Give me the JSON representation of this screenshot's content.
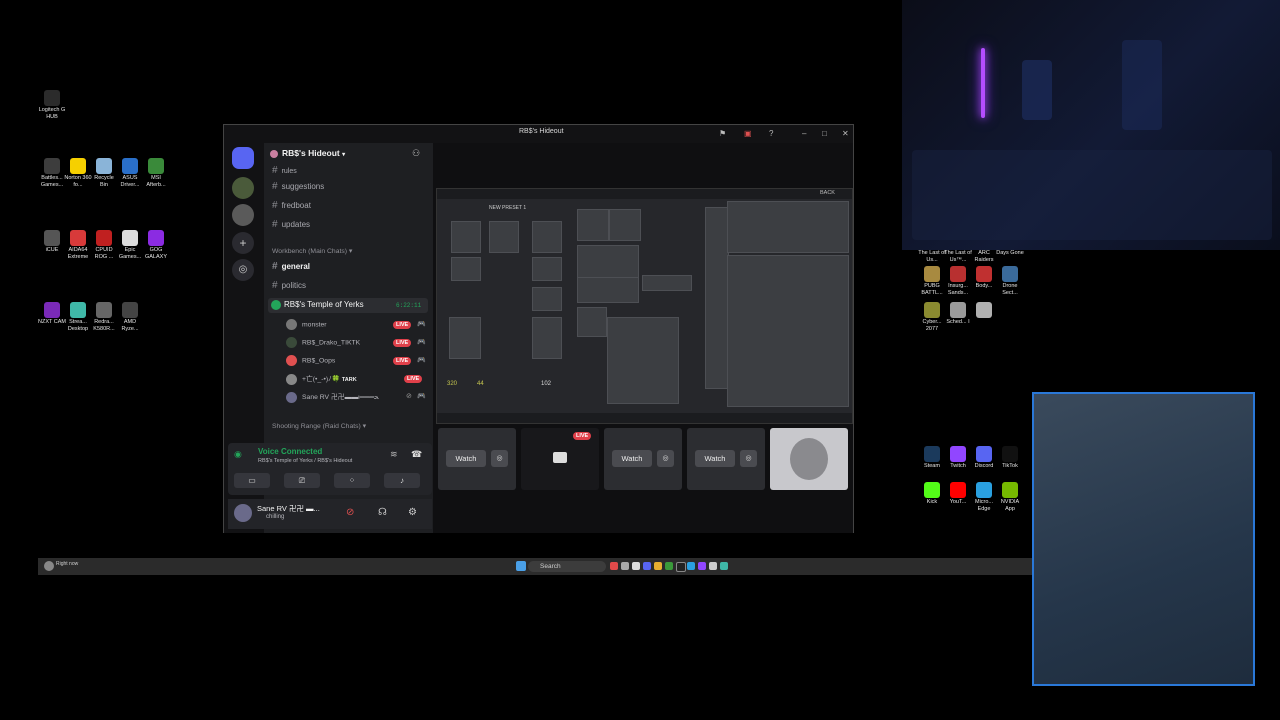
{
  "desktop_icons": [
    {
      "label": "Logitech G HUB",
      "color": "#2b2b2b"
    },
    {
      "label": "Battles... Games...",
      "color": "#3d3d3d"
    },
    {
      "label": "Norton 360 fo...",
      "color": "#f6d000"
    },
    {
      "label": "Recycle Bin",
      "color": "#8ab4d8"
    },
    {
      "label": "ASUS Driver...",
      "color": "#2a6fc9"
    },
    {
      "label": "MSI Afterb...",
      "color": "#3a8a3a"
    },
    {
      "label": "iCUE",
      "color": "#555555"
    },
    {
      "label": "AIDA64 Extreme",
      "color": "#d83a3a"
    },
    {
      "label": "CPUID ROG ...",
      "color": "#c02020"
    },
    {
      "label": "Epic Games...",
      "color": "#dddddd"
    },
    {
      "label": "GOG GALAXY",
      "color": "#8b2be2"
    },
    {
      "label": "NZXT CAM",
      "color": "#7a2ab8"
    },
    {
      "label": "Strea... Desktop",
      "color": "#3fb8a8"
    },
    {
      "label": "Redra... K580R...",
      "color": "#666666"
    },
    {
      "label": "AMD Ryze...",
      "color": "#444444"
    },
    {
      "label": "The Last of Us...",
      "color": "#4a4a4a"
    },
    {
      "label": "The Last of Us™...",
      "color": "#4a4a4a"
    },
    {
      "label": "ARC Raiders",
      "color": "#4a4a4a"
    },
    {
      "label": "Days Gone",
      "color": "#4a4a4a"
    },
    {
      "label": "PUBG BATTL...",
      "color": "#a88a40"
    },
    {
      "label": "Insurg... Sands...",
      "color": "#b83030"
    },
    {
      "label": "Body...",
      "color": "#c03030"
    },
    {
      "label": "Drone Sect...",
      "color": "#3a6a9a"
    },
    {
      "label": "Cyber... 2077",
      "color": "#8a8a30"
    },
    {
      "label": "Sched... I",
      "color": "#9a9a9a"
    },
    {
      "label": "",
      "color": "#b0b0b0"
    },
    {
      "label": "Steam",
      "color": "#1b3a5c"
    },
    {
      "label": "Twitch",
      "color": "#9146ff"
    },
    {
      "label": "Discord",
      "color": "#5865f2"
    },
    {
      "label": "TikTok",
      "color": "#111111"
    },
    {
      "label": "Kick",
      "color": "#53fc18"
    },
    {
      "label": "YouT...",
      "color": "#ff0000"
    },
    {
      "label": "Micro... Edge",
      "color": "#2aa0e0"
    },
    {
      "label": "NVIDIA App",
      "color": "#76b900"
    }
  ],
  "taskbar": {
    "search_placeholder": "Search",
    "weather_text": "Right now"
  },
  "discord": {
    "title": "RB$'s Hideout",
    "server_name": "RB$'s Hideout",
    "channels_top": [
      {
        "name": "rules"
      },
      {
        "name": "suggestions"
      },
      {
        "name": "fredboat"
      },
      {
        "name": "updates"
      }
    ],
    "category_main": "Workbench (Main Chats)",
    "channels_main": [
      {
        "name": "general"
      },
      {
        "name": "politics"
      }
    ],
    "voice_channel": {
      "name": "RB$'s Temple of Yerks",
      "timer": "6:22:11"
    },
    "voice_users": [
      {
        "name": "monster",
        "live": "LIVE"
      },
      {
        "name": "RB$_Drako_TIKTK",
        "live": "LIVE"
      },
      {
        "name": "RB$_Oops",
        "live": "LIVE"
      },
      {
        "name": "+亡(•_-•)ﾉ🍀",
        "tag": "TARK",
        "live": "LIVE"
      },
      {
        "name": "Sane RV 卍卍▬▬ι═══ﺤ",
        "live": ""
      }
    ],
    "category_raid": "Shooting Range (Raid Chats)",
    "voice_status": {
      "title": "Voice Connected",
      "subtitle": "RB$'s Temple of Yerks / RB$'s Hideout"
    },
    "user": {
      "name": "Sane RV 卍卍 ▬...",
      "status": "chilling"
    },
    "stream_game": {
      "tab_label": "BACK",
      "preset": "NEW PRESET 1",
      "stats": [
        "320",
        "44",
        "102"
      ]
    },
    "tiles": [
      {
        "watch": "Watch",
        "live": ""
      },
      {
        "watch": "",
        "live": "LIVE"
      },
      {
        "watch": "Watch",
        "live": ""
      },
      {
        "watch": "Watch",
        "live": ""
      },
      {
        "watch": "",
        "live": ""
      }
    ]
  }
}
